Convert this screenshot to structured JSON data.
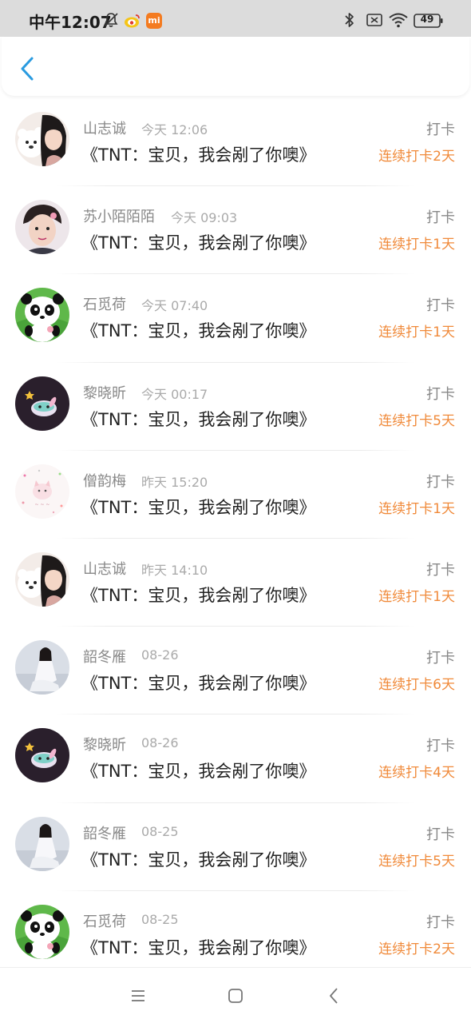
{
  "status_bar": {
    "time": "中午12:07",
    "mi_badge": "mi",
    "battery": "49",
    "icons": [
      "bell-off-icon",
      "weibo-icon",
      "mi-icon",
      "bluetooth-icon",
      "no-sim-icon",
      "wifi-icon",
      "battery-icon"
    ]
  },
  "header": {
    "back_icon": "chevron-left-icon",
    "accent_color": "#2a9be0"
  },
  "colors": {
    "streak": "#f08a3a",
    "name": "#888888",
    "title": "#222222"
  },
  "items": [
    {
      "name": "山志诚",
      "time": "今天 12:06",
      "title": "《TNT：宝贝，我会剐了你噢》",
      "action": "打卡",
      "streak": "连续打卡2天",
      "avatar": "girl-bear"
    },
    {
      "name": "苏小陌陌陌",
      "time": "今天 09:03",
      "title": "《TNT：宝贝，我会剐了你噢》",
      "action": "打卡",
      "streak": "连续打卡1天",
      "avatar": "boy"
    },
    {
      "name": "石觅荷",
      "time": "今天 07:40",
      "title": "《TNT：宝贝，我会剐了你噢》",
      "action": "打卡",
      "streak": "连续打卡1天",
      "avatar": "panda"
    },
    {
      "name": "黎晓昕",
      "time": "今天 00:17",
      "title": "《TNT：宝贝，我会剐了你噢》",
      "action": "打卡",
      "streak": "连续打卡5天",
      "avatar": "dark-cartoon"
    },
    {
      "name": "僧韵梅",
      "time": "昨天 15:20",
      "title": "《TNT：宝贝，我会剐了你噢》",
      "action": "打卡",
      "streak": "连续打卡1天",
      "avatar": "pink-cat"
    },
    {
      "name": "山志诚",
      "time": "昨天 14:10",
      "title": "《TNT：宝贝，我会剐了你噢》",
      "action": "打卡",
      "streak": "连续打卡1天",
      "avatar": "girl-bear"
    },
    {
      "name": "韶冬雁",
      "time": "08-26",
      "title": "《TNT：宝贝，我会剐了你噢》",
      "action": "打卡",
      "streak": "连续打卡6天",
      "avatar": "girl-white"
    },
    {
      "name": "黎晓昕",
      "time": "08-26",
      "title": "《TNT：宝贝，我会剐了你噢》",
      "action": "打卡",
      "streak": "连续打卡4天",
      "avatar": "dark-cartoon"
    },
    {
      "name": "韶冬雁",
      "time": "08-25",
      "title": "《TNT：宝贝，我会剐了你噢》",
      "action": "打卡",
      "streak": "连续打卡5天",
      "avatar": "girl-white"
    },
    {
      "name": "石觅荷",
      "time": "08-25",
      "title": "《TNT：宝贝，我会剐了你噢》",
      "action": "打卡",
      "streak": "连续打卡2天",
      "avatar": "panda"
    }
  ],
  "nav_bar": {
    "icons": [
      "menu-icon",
      "home-icon",
      "back-icon"
    ]
  }
}
